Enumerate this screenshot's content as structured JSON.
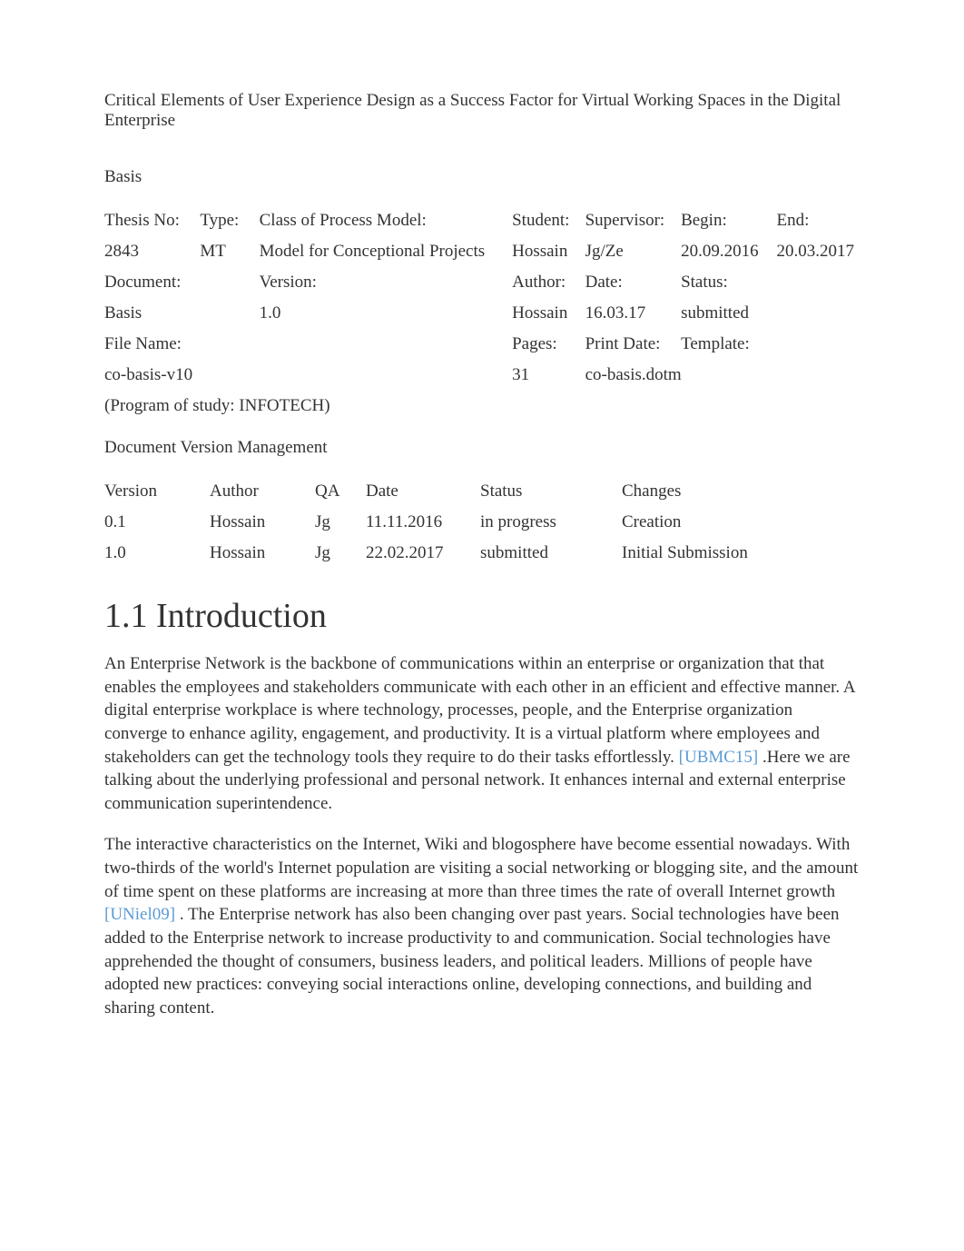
{
  "title": "Critical Elements of User Experience Design as a Success Factor for Virtual Working Spaces in the Digital Enterprise",
  "basis": {
    "heading": "Basis",
    "labels": {
      "thesis_no": "Thesis No:",
      "type": "Type:",
      "class_model": "Class of Process Model:",
      "student": "Student:",
      "supervisor": "Supervisor:",
      "begin": "Begin:",
      "end": "End:",
      "document": "Document:",
      "version": "Version:",
      "author": "Author:",
      "date": "Date:",
      "status": "Status:",
      "file_name": "File Name:",
      "pages": "Pages:",
      "print_date": "Print Date:",
      "template": "Template:"
    },
    "values": {
      "thesis_no": "2843",
      "type": "MT",
      "class_model": "Model for Conceptional Projects",
      "student": "Hossain",
      "supervisor": "Jg/Ze",
      "begin": "20.09.2016",
      "end": "20.03.2017",
      "document": "Basis",
      "version": "1.0",
      "author": "Hossain",
      "date": "16.03.17",
      "status": "submitted",
      "file_name": "co-basis-v10",
      "pages": "31",
      "print_date": "",
      "template": "co-basis.dotm"
    },
    "program_note": "(Program of study: INFOTECH)"
  },
  "version_mgmt": {
    "heading": "Document Version Management",
    "headers": [
      "Version",
      "Author",
      "QA",
      "Date",
      "Status",
      "Changes"
    ],
    "rows": [
      {
        "version": "0.1",
        "author": "Hossain",
        "qa": "Jg",
        "date": "11.11.2016",
        "status": "in progress",
        "changes": "Creation"
      },
      {
        "version": "1.0",
        "author": "Hossain",
        "qa": "Jg",
        "date": "22.02.2017",
        "status": "submitted",
        "changes": "Initial Submission"
      }
    ]
  },
  "intro": {
    "heading": "1.1 Introduction",
    "p1_a": "An Enterprise Network is the backbone of communications within an enterprise or organization that that enables the employees and stakeholders communicate with each other in an efficient and effective manner. A digital enterprise workplace is where technology, processes, people, and the Enterprise organization converge to enhance agility, engagement, and productivity. It is a virtual platform where employees and stakeholders can get the technology tools they require to do their tasks effortlessly. ",
    "ref1": "[UBMC15]",
    "p1_b": " .Here we are talking about the underlying professional and personal network. It enhances internal and external enterprise communication superintendence.",
    "p2_a": "The interactive characteristics on the Internet, Wiki and blogosphere have become essential nowadays. With two-thirds of the world's Internet population are visiting a social networking or blogging site, and the amount of time spent on these platforms are increasing at more than three times the rate of overall Internet growth ",
    "ref2": "[UNiel09]",
    "p2_b": " . The Enterprise network has also been changing over past years. Social technologies have been added to the Enterprise network to increase productivity to and communication. Social technologies have apprehended the thought of consumers, business leaders, and political leaders. Millions of people have adopted new practices: conveying social interactions online, developing connections, and building and sharing content."
  }
}
